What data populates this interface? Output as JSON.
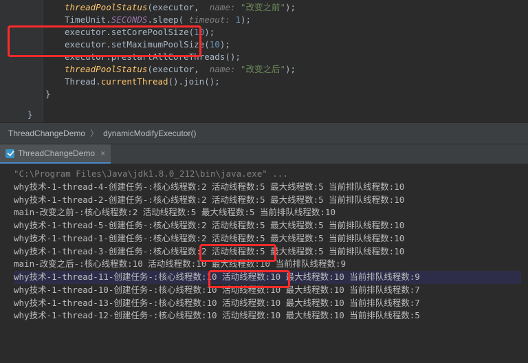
{
  "code": {
    "l1_fn": "threadPoolStatus",
    "l1_arg": "executor",
    "l1_name": "name:",
    "l1_str": "\"改变之前\"",
    "l2_cls": "TimeUnit",
    "l2_fld": "SECONDS",
    "l2_m": "sleep",
    "l2_arg": "timeout:",
    "l2_num": "1",
    "l3_a": "executor",
    "l3_m": "setCorePoolSize",
    "l3_n": "10",
    "l4_a": "executor",
    "l4_m": "setMaximumPoolSize",
    "l4_n": "10",
    "l5_a": "executor",
    "l5_m": "prestartAllCoreThreads",
    "l6_fn": "threadPoolStatus",
    "l6_arg": "executor",
    "l6_name": "name:",
    "l6_str": "\"改变之后\"",
    "l7_cls": "Thread",
    "l7_m": "currentThread",
    "l7_m2": "join",
    "l8": "}",
    "l9": "}"
  },
  "breadcrumb": {
    "a": "ThreadChangeDemo",
    "b": "dynamicModifyExecutor()"
  },
  "tab": {
    "title": "ThreadChangeDemo",
    "close": "×"
  },
  "console": {
    "cmd": "\"C:\\Program Files\\Java\\jdk1.8.0_212\\bin\\java.exe\" ...",
    "pre": "why技术-1-thread-",
    "pre2": "-创建任务-:",
    "c": "核心线程数:",
    "a": "活动线程数:",
    "m": "最大线程数:",
    "q": "当前排队线程数:",
    "main_before": "main-改变之前-:核心线程数:2 活动线程数:5 最大线程数:5 当前排队线程数:10",
    "main_after": "main-改变之后-:核心线程数:10 活动线程数:10 最大线程数:10 当前排队线程数:9",
    "r": [
      {
        "t": "4",
        "core": "2",
        "act": "5",
        "max": "5",
        "q": "10"
      },
      {
        "t": "2",
        "core": "2",
        "act": "5",
        "max": "5",
        "q": "10"
      }
    ],
    "r2": [
      {
        "t": "5",
        "core": "2",
        "act": "5",
        "max": "5",
        "q": "10"
      },
      {
        "t": "1",
        "core": "2",
        "act": "5",
        "max": "5",
        "q": "10"
      },
      {
        "t": "3",
        "core": "2",
        "act": "5",
        "max": "5",
        "q": "10"
      }
    ],
    "r3": [
      {
        "t": "11",
        "core": "10",
        "act": "10",
        "max": "10",
        "q": "9"
      },
      {
        "t": "10",
        "core": "10",
        "act": "10",
        "max": "10",
        "q": "7"
      },
      {
        "t": "13",
        "core": "10",
        "act": "10",
        "max": "10",
        "q": "7"
      },
      {
        "t": "12",
        "core": "10",
        "act": "10",
        "max": "10",
        "q": "5"
      }
    ]
  }
}
